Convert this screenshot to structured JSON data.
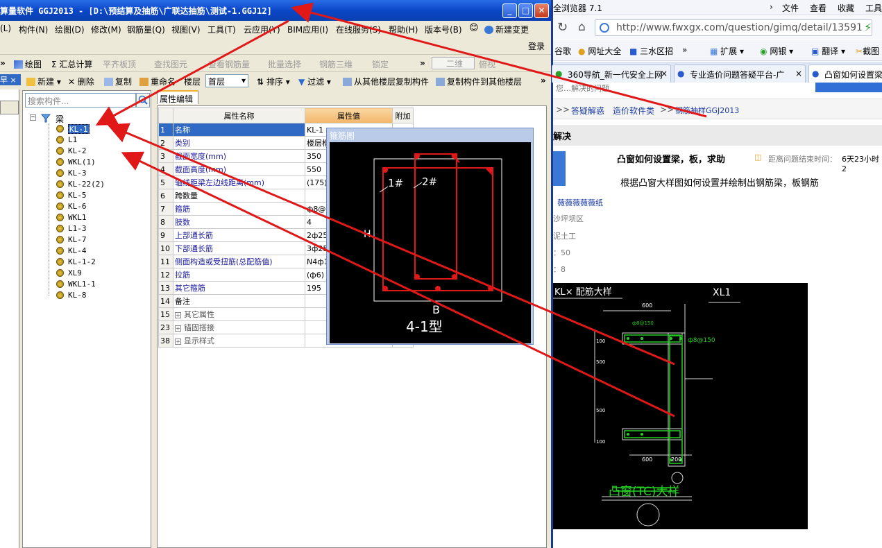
{
  "app": {
    "title": "算量软件 GGJ2013 - [D:\\预结算及抽筋\\广联达抽筋\\测试-1.GGJ12]",
    "menu": [
      "(L)",
      "构件(N)",
      "绘图(D)",
      "修改(M)",
      "钢筋量(Q)",
      "视图(V)",
      "工具(T)",
      "云应用(Y)",
      "BIM应用(I)",
      "在线服务(S)",
      "帮助(H)",
      "版本号(B)",
      "新建变更"
    ],
    "login": "登录",
    "toolbar1": [
      "绘图",
      "Σ 汇总计算",
      "平齐板顶",
      "查找图元",
      "查看钢筋量",
      "批量选择",
      "钢筋三维",
      "锁定",
      "二维",
      "俯视"
    ],
    "toolbar2": [
      "新建",
      "删除",
      "复制",
      "重命名",
      "楼层",
      "首层",
      "排序",
      "过滤",
      "从其他楼层复制构件",
      "复制构件到其他楼层"
    ],
    "nav_head": "早 ×",
    "search_placeholder": "搜索构件...",
    "tree_root": "梁",
    "tree_items": [
      "KL-1",
      "L1",
      "KL-2",
      "WKL(1)",
      "KL-3",
      "KL-22(2)",
      "KL-5",
      "KL-6",
      "WKL1",
      "L1-3",
      "KL-7",
      "KL-4",
      "KL-1-2",
      "XL9",
      "WKL1-1",
      "KL-8"
    ],
    "prop_tab": "属性编辑",
    "prop_headers": [
      "属性名称",
      "属性值",
      "附加"
    ],
    "props": [
      {
        "n": "1",
        "k": "名称",
        "v": "KL-1"
      },
      {
        "n": "2",
        "k": "类别",
        "v": "楼层框"
      },
      {
        "n": "3",
        "k": "截面宽度(mm)",
        "v": "350"
      },
      {
        "n": "4",
        "k": "截面高度(mm)",
        "v": "550"
      },
      {
        "n": "5",
        "k": "轴线距梁左边线距离(mm)",
        "v": "(175)"
      },
      {
        "n": "6",
        "k": "跨数量",
        "v": ""
      },
      {
        "n": "7",
        "k": "箍筋",
        "v": "ф8@1"
      },
      {
        "n": "8",
        "k": "肢数",
        "v": "4"
      },
      {
        "n": "9",
        "k": "上部通长筋",
        "v": "2ф25"
      },
      {
        "n": "10",
        "k": "下部通长筋",
        "v": "3ф25"
      },
      {
        "n": "11",
        "k": "侧面构造或受扭筋(总配筋值)",
        "v": "N4ф1"
      },
      {
        "n": "12",
        "k": "拉筋",
        "v": "(ф6)"
      },
      {
        "n": "13",
        "k": "其它箍筋",
        "v": "195"
      },
      {
        "n": "14",
        "k": "备注",
        "v": ""
      },
      {
        "n": "15",
        "k": "其它属性",
        "v": ""
      },
      {
        "n": "23",
        "k": "锚固搭接",
        "v": ""
      },
      {
        "n": "38",
        "k": "显示样式",
        "v": ""
      }
    ],
    "popup_title": "箍筋图",
    "popup_labels": {
      "l1": "1#",
      "l2": "2#",
      "b": "B",
      "type": "4-1型",
      "h": "H"
    }
  },
  "browser": {
    "title": "全浏览器 7.1",
    "menu": [
      "文件",
      "查看",
      "收藏",
      "工具"
    ],
    "url": "http://www.fwxgx.com/question/gimq/detail/13591",
    "favorites": [
      "谷歌",
      "网址大全",
      "三水区招",
      "扩展",
      "网银",
      "翻译",
      "截图"
    ],
    "tabs": [
      "360导航_新一代安全上网",
      "专业造价问题答疑平台-广",
      "凸窗如何设置梁"
    ],
    "search_hint": "您…解决的问题",
    "breadcrumb": [
      "答疑解惑",
      "造价软件类",
      "钢筋抽样GGJ2013"
    ],
    "section": "解决",
    "question_title": "凸窗如何设置梁，板，求助",
    "timer_label": "距离问题结束时间：",
    "timer_value": "6天23小时2",
    "question_body": "根据凸窗大样图如何设置并绘制出钢筋梁，板钢筋",
    "user": "薇薇薇薇薇纸",
    "meta": [
      "沙坪坝区",
      "泥土工",
      "：50",
      "：8"
    ],
    "cad": {
      "kl": "KL× 配筋大样",
      "xl": "XL1",
      "w600": "600",
      "n8": "ф8@150",
      "sheet": "凸窗(TC)大样",
      "w200": "200",
      "d500": "500",
      "d500b": "500",
      "d100": "100",
      "d100b": "100"
    }
  },
  "colors": {
    "accent": "#316ac5",
    "titlebar": "#0a47c8",
    "rebar": "#e01818",
    "cadgreen": "#22d022"
  }
}
